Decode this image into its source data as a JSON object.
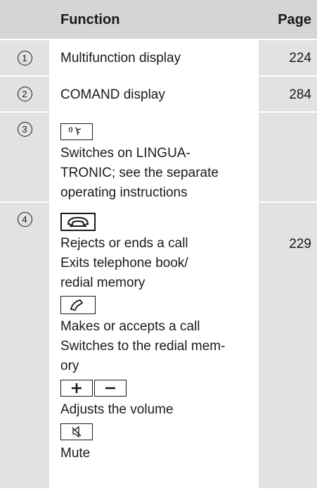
{
  "header": {
    "function": "Function",
    "page": "Page"
  },
  "rows": [
    {
      "num": "1",
      "text": "Multifunction display",
      "page": "224"
    },
    {
      "num": "2",
      "text": "COMAND display",
      "page": "284"
    },
    {
      "num": "3",
      "lines": [
        "Switches on LINGUA-",
        "TRONIC; see the separate",
        "operating instructions"
      ],
      "page": ""
    },
    {
      "num": "4",
      "page": "229",
      "lines_a": [
        "Rejects or ends a call",
        "Exits telephone book/",
        "redial memory"
      ],
      "lines_b": [
        "Makes or accepts a call",
        "Switches to the redial mem-",
        "ory"
      ],
      "lines_c": [
        "Adjusts the volume"
      ],
      "lines_d": [
        "Mute"
      ]
    }
  ],
  "icons": [
    "voice-control-icon",
    "end-call-icon",
    "accept-call-icon",
    "plus-icon",
    "minus-icon",
    "mute-icon"
  ]
}
